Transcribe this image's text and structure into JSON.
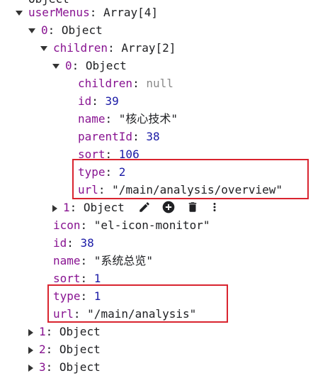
{
  "tree": {
    "top_fragment": "Object",
    "userMenus": {
      "key": "userMenus",
      "type": "Array[4]"
    },
    "item0": {
      "key": "0",
      "type": "Object"
    },
    "children": {
      "key": "children",
      "type": "Array[2]"
    },
    "child0": {
      "key": "0",
      "type": "Object",
      "fields": {
        "children": {
          "key": "children",
          "value": "null"
        },
        "id": {
          "key": "id",
          "value": "39"
        },
        "name": {
          "key": "name",
          "value": "\"核心技术\""
        },
        "parentId": {
          "key": "parentId",
          "value": "38"
        },
        "sort": {
          "key": "sort",
          "value": "106"
        },
        "type": {
          "key": "type",
          "value": "2"
        },
        "url": {
          "key": "url",
          "value": "\"/main/analysis/overview\""
        }
      }
    },
    "child1": {
      "key": "1",
      "type": "Object"
    },
    "item0_fields": {
      "icon": {
        "key": "icon",
        "value": "\"el-icon-monitor\""
      },
      "id": {
        "key": "id",
        "value": "38"
      },
      "name": {
        "key": "name",
        "value": "\"系统总览\""
      },
      "sort": {
        "key": "sort",
        "value": "1"
      },
      "type": {
        "key": "type",
        "value": "1"
      },
      "url": {
        "key": "url",
        "value": "\"/main/analysis\""
      }
    },
    "item1": {
      "key": "1",
      "type": "Object"
    },
    "item2": {
      "key": "2",
      "type": "Object"
    },
    "item3": {
      "key": "3",
      "type": "Object"
    }
  },
  "row_tools": [
    "edit-icon",
    "add-circle-icon",
    "delete-icon",
    "more-vert-icon"
  ],
  "colors": {
    "key": "#881391",
    "number": "#1a1aa6",
    "null": "#8a8a8a",
    "highlight": "#d9242f"
  }
}
